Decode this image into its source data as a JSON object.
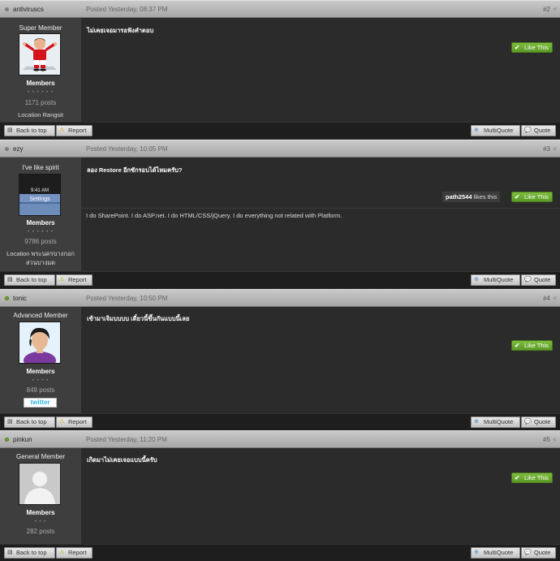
{
  "like_label": "Like This",
  "footer": {
    "back_to_top": "Back to top",
    "report": "Report",
    "multiquote": "MultiQuote",
    "quote": "Quote"
  },
  "posts": [
    {
      "username": "antiviruscs",
      "date": "Posted Yesterday, 08:37 PM",
      "number": "#2",
      "user_title": "Super Member",
      "rank": "Members",
      "stars": "• • • • • •",
      "post_count": "1171 posts",
      "location": "Location Rangsit",
      "message": "ไม่เคยเจอมารอฟังคำตอบ",
      "online": false
    },
    {
      "username": "ezy",
      "date": "Posted Yesterday, 10:05 PM",
      "number": "#3",
      "user_title": "I've like spirit",
      "rank": "Members",
      "stars": "• • • • • •",
      "post_count": "9786 posts",
      "location": "Location พระนครบางกอกสวนบางมด",
      "message": "ลอง Restore อีกซักรอบได้ไหมครับ?",
      "likes_user": "path2544",
      "likes_text": "likes this",
      "signature": "I do SharePoint. I do ASP.net. I do HTML/CSS/jQuery. I do everything not related with  Platform.",
      "avatar_text": {
        "time": "9:41 AM",
        "label": "Settings"
      },
      "online": false
    },
    {
      "username": "tonic",
      "date": "Posted Yesterday, 10:50 PM",
      "number": "#4",
      "user_title": "Advanced Member",
      "rank": "Members",
      "stars": "• • • •",
      "post_count": "849 posts",
      "badge": "twitter",
      "message": "เข้ามาเจิมบบบบ เดี๋ยวนี้ขึ้นกันแบบนี้เลย",
      "online": true
    },
    {
      "username": "pinkun",
      "date": "Posted Yesterday, 11:20 PM",
      "number": "#5",
      "user_title": "General Member",
      "rank": "Members",
      "stars": "• • •",
      "post_count": "282 posts",
      "message": "เกิดมาไม่เคยเจอแบบนี้ครับ",
      "online": true
    }
  ],
  "colors": {
    "header": "#b8b8b8",
    "sidebar": "#3e3e3e",
    "body": "#2b2b2b",
    "like": "#6aab2f",
    "footer": "#1e1e1e"
  }
}
